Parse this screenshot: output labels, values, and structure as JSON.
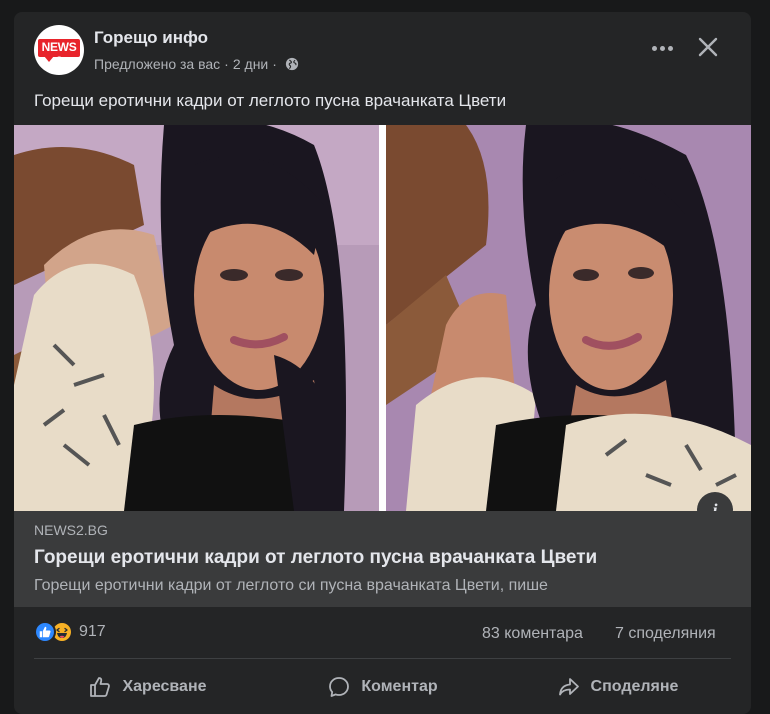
{
  "post": {
    "page_name": "Горещо инфо",
    "avatar_logo": "NEWS 2",
    "meta_suggested": "Предложено за вас",
    "meta_time": "2 дни",
    "text": "Горещи еротични кадри от леглото пусна врачанката Цвети"
  },
  "link_preview": {
    "domain": "NEWS2.BG",
    "title": "Горещи еротични кадри от леглото пусна врачанката Цвети",
    "description": "Горещи еротични кадри от леглото си пусна врачанката Цвети, пише"
  },
  "stats": {
    "reaction_icons": [
      "like-icon",
      "haha-icon"
    ],
    "reactions_count": "917",
    "comments": "83 коментара",
    "shares": "7 споделяния"
  },
  "actions": {
    "like_label": "Харесване",
    "comment_label": "Коментар",
    "share_label": "Споделяне"
  },
  "colors": {
    "background": "#18191a",
    "card": "#242526",
    "link_preview_bg": "#3a3b3c",
    "primary_text": "#e4e6eb",
    "secondary_text": "#b0b3b8",
    "like_blue": "#2d88ff",
    "haha_yellow": "#f7b125",
    "brand_red": "#e8242b"
  }
}
